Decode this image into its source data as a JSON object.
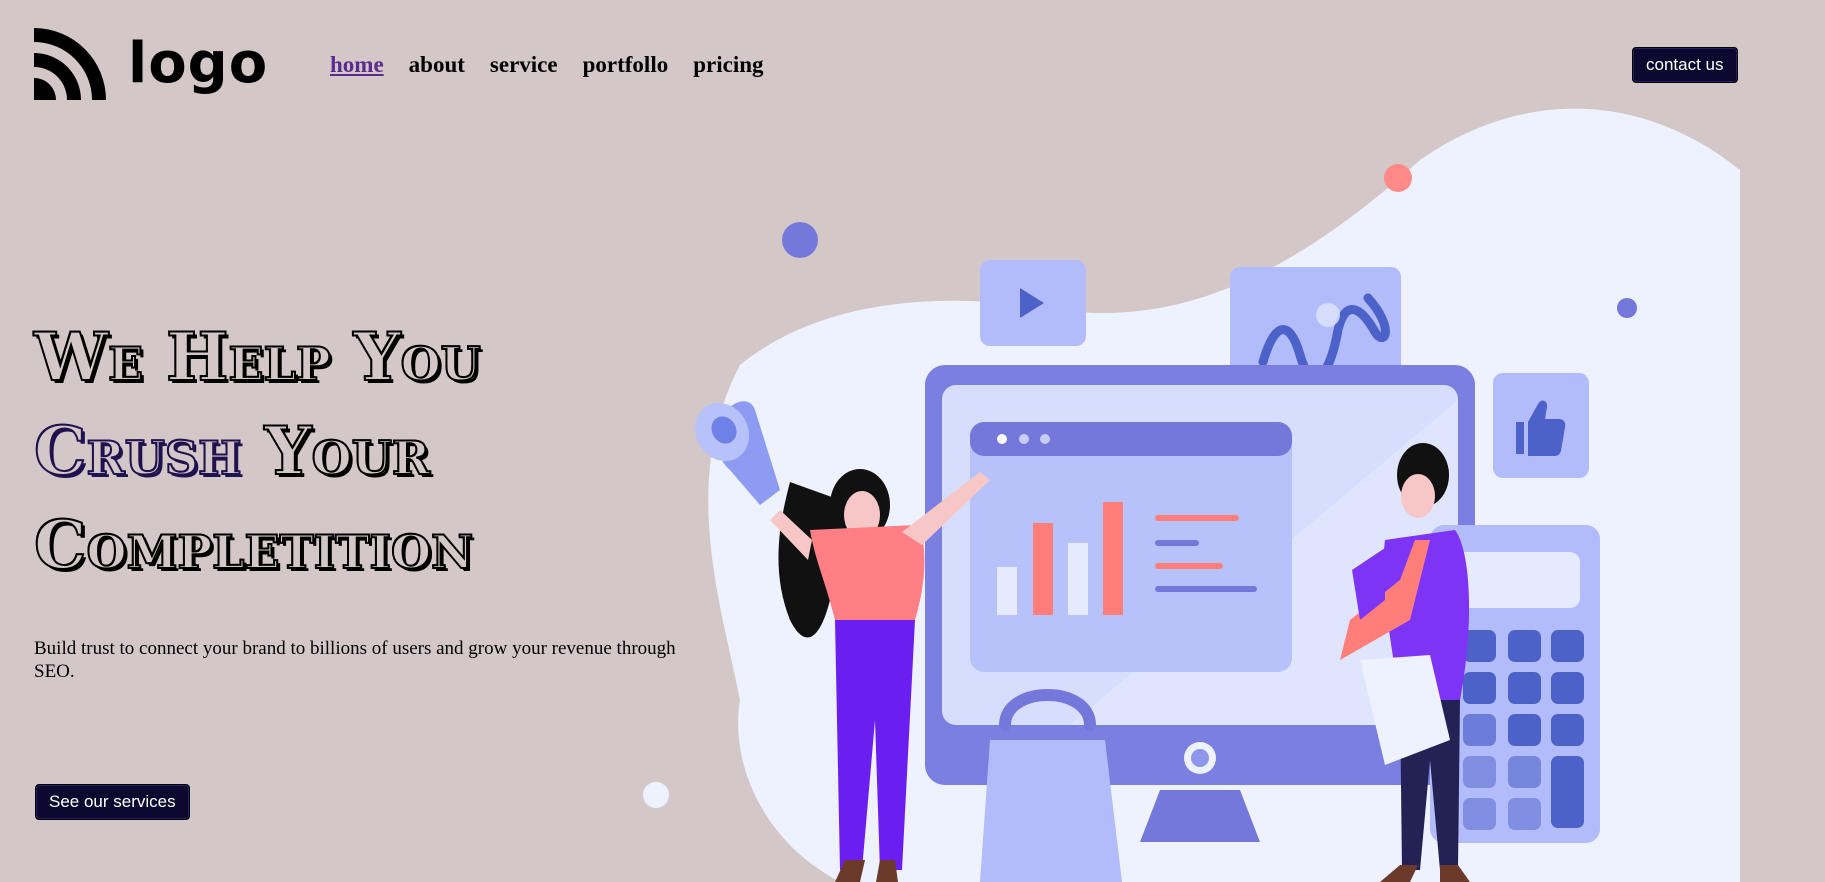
{
  "logo": {
    "text": "logo",
    "icon": "signal-arcs-icon"
  },
  "nav": {
    "items": [
      {
        "label": "home",
        "active": true
      },
      {
        "label": "about"
      },
      {
        "label": "service"
      },
      {
        "label": "portfollo"
      },
      {
        "label": "pricing"
      }
    ]
  },
  "header": {
    "contact_label": "contact us"
  },
  "hero": {
    "headline_line1": "We Help You",
    "headline_line2_accent": "Crush",
    "headline_line2_rest": "Your",
    "headline_line3": "Completition",
    "subtitle": "Build trust to connect your brand to billions of users and grow your revenue through SEO.",
    "cta_label": "See our services"
  },
  "colors": {
    "background": "#d3c8c7",
    "button": "#0d0830",
    "nav_active": "#5b2a8e",
    "blob": "#eef2ff",
    "illustration_primary": "#7478db",
    "illustration_accent": "#ff7e7a"
  },
  "illustration": {
    "icon": "digital-marketing-illustration"
  }
}
